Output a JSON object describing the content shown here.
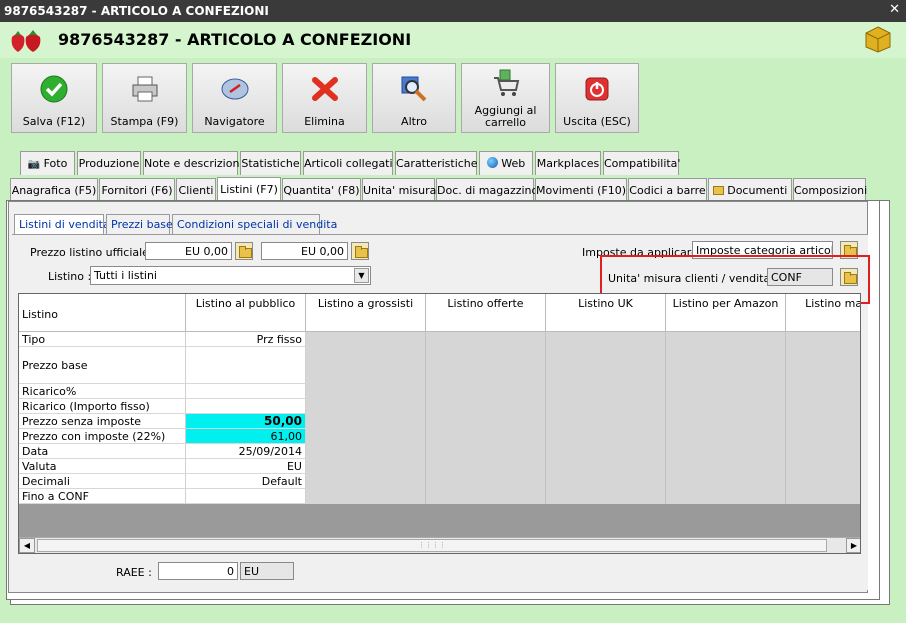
{
  "window": {
    "title": "9876543287 - ARTICOLO A CONFEZIONI",
    "close_glyph": "✕"
  },
  "header": {
    "title": "9876543287 - ARTICOLO A CONFEZIONI",
    "logo_icon": "strawberry-icon",
    "app_icon": "cubes-icon"
  },
  "toolbar": {
    "save": "Salva (F12)",
    "print": "Stampa (F9)",
    "navigator": "Navigatore",
    "delete": "Elimina",
    "other": "Altro",
    "add_cart_1": "Aggiungi al",
    "add_cart_2": "carrello",
    "exit": "Uscita (ESC)"
  },
  "tabs_top": [
    "Foto",
    "Produzione",
    "Note e descrizioni",
    "Statistiche",
    "Articoli collegati",
    "Caratteristiche",
    "Web",
    "Markplaces",
    "Compatibilita'"
  ],
  "tabs_main": [
    "Anagrafica (F5)",
    "Fornitori (F6)",
    "Clienti",
    "Listini (F7)",
    "Quantita' (F8)",
    "Unita' misura",
    "Doc. di magazzino",
    "Movimenti (F10)",
    "Codici a barre",
    "Documenti",
    "Composizioni"
  ],
  "subtabs": [
    "Listini di vendita",
    "Prezzi base",
    "Condizioni speciali di vendita"
  ],
  "form": {
    "prezzo_label": "Prezzo listino ufficiale :",
    "prezzo_value_1": "EU 0,00",
    "prezzo_value_2": "EU 0,00",
    "imposte_label": "Imposte da applicare :",
    "imposte_value": "Imposte categoria articolo",
    "listino_label": "Listino :",
    "listino_value": "Tutti i listini",
    "unita_label": "Unita' misura clienti / vendita :",
    "unita_value": "CONF",
    "raee_label": "RAEE :",
    "raee_value": "0",
    "raee_currency": "EU"
  },
  "grid": {
    "header_row_label": "Listino",
    "columns": [
      "Listino al pubblico",
      "Listino a grossisti",
      "Listino offerte",
      "Listino UK",
      "Listino per Amazon",
      "Listino maggio"
    ],
    "rows": [
      {
        "label": "Tipo",
        "value": "Prz fisso"
      },
      {
        "label": "Prezzo base",
        "value": ""
      },
      {
        "label": "Ricarico%",
        "value": ""
      },
      {
        "label": "Ricarico (Importo fisso)",
        "value": ""
      },
      {
        "label": "Prezzo senza imposte",
        "value": "50,00"
      },
      {
        "label": "Prezzo con imposte (22%)",
        "value": "61,00"
      },
      {
        "label": "Data",
        "value": "25/09/2014"
      },
      {
        "label": "Valuta",
        "value": "EU"
      },
      {
        "label": "Decimali",
        "value": "Default"
      },
      {
        "label": "Fino a CONF",
        "value": ""
      }
    ]
  }
}
